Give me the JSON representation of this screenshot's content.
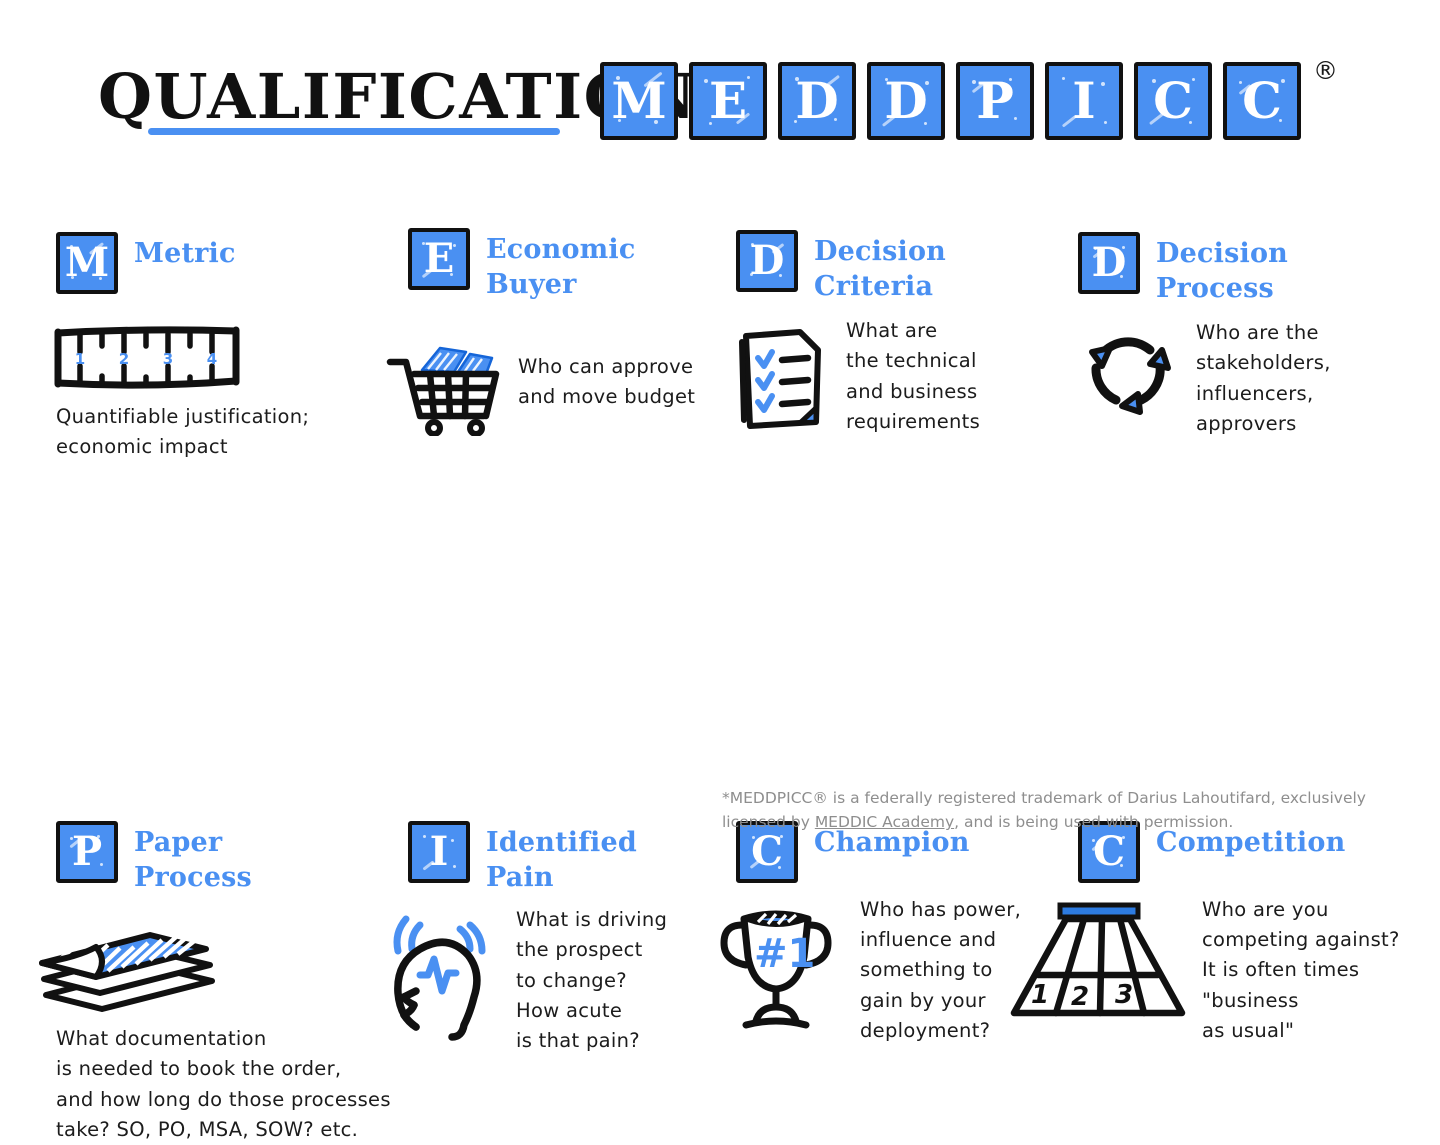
{
  "header": {
    "title": "QUALIFICATION",
    "trademark_symbol": "®",
    "accent_color": "#4a90f2",
    "tiles": [
      {
        "letter": "M"
      },
      {
        "letter": "E"
      },
      {
        "letter": "D"
      },
      {
        "letter": "D"
      },
      {
        "letter": "P"
      },
      {
        "letter": "I"
      },
      {
        "letter": "C"
      },
      {
        "letter": "C"
      }
    ]
  },
  "cards": [
    {
      "letter": "M",
      "title": "Metric",
      "icon": "ruler-icon",
      "icon_labels": [
        "1",
        "2",
        "3",
        "4"
      ],
      "body": "Quantifiable justification;\neconomic impact"
    },
    {
      "letter": "E",
      "title": "Economic\nBuyer",
      "icon": "shopping-cart-icon",
      "body": "Who can approve\nand move budget"
    },
    {
      "letter": "D",
      "title": "Decision\nCriteria",
      "icon": "checklist-document-icon",
      "body": "What are\nthe technical\nand business\nrequirements"
    },
    {
      "letter": "D",
      "title": "Decision\nProcess",
      "icon": "cycle-arrows-icon",
      "body": "Who are the\nstakeholders,\ninfluencers,\napprovers"
    },
    {
      "letter": "P",
      "title": "Paper\nProcess",
      "icon": "paper-stack-icon",
      "body": "What documentation\nis needed to book the order,\nand how long do those processes\ntake? SO, PO, MSA, SOW? etc."
    },
    {
      "letter": "I",
      "title": "Identified\nPain",
      "icon": "head-pain-icon",
      "body": "What is driving\nthe prospect\nto change?\nHow acute\nis that pain?"
    },
    {
      "letter": "C",
      "title": "Champion",
      "icon": "trophy-icon",
      "icon_label": "#1",
      "body": "Who has power,\ninfluence and\nsomething to\ngain by your\ndeployment?"
    },
    {
      "letter": "C",
      "title": "Competition",
      "icon": "running-track-icon",
      "icon_labels": [
        "1",
        "2",
        "3"
      ],
      "body": "Who are you\ncompeting against?\nIt is often times\n\"business\n      as usual\""
    }
  ],
  "footnote": {
    "part1": "*MEDDPICC® is a federally registered trademark of Darius Lahoutifard, exclusively licensed by ",
    "link": "MEDDIC Academy",
    "part2": ", and is being used with permission."
  }
}
